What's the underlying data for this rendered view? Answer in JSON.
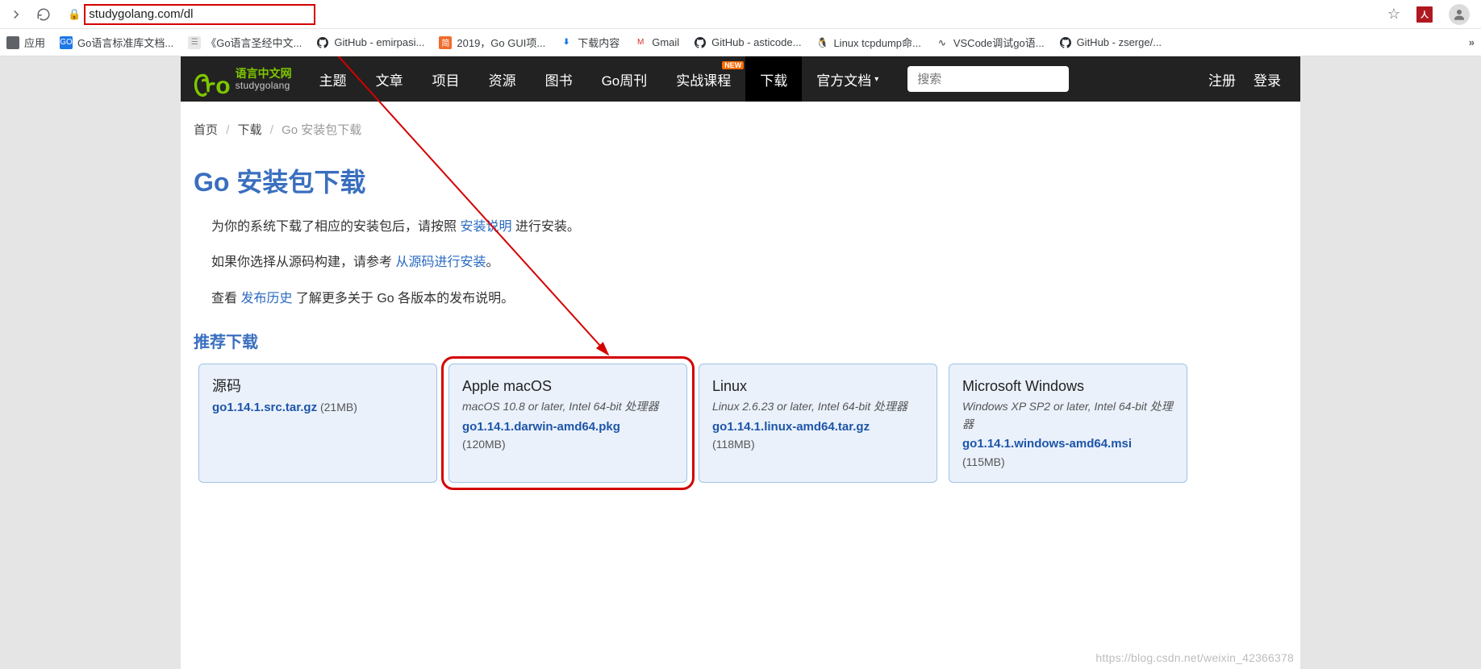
{
  "browser": {
    "url": "studygolang.com/dl",
    "bookmarks": [
      {
        "label": "应用",
        "icon_bg": "#5f6368",
        "icon_text": ""
      },
      {
        "label": "Go语言标准库文档...",
        "icon_bg": "#1e78e6",
        "icon_text": "GO"
      },
      {
        "label": "《Go语言圣经中文...",
        "icon_bg": "#e8e8e8",
        "icon_text": "☰",
        "icon_fg": "#888"
      },
      {
        "label": "GitHub - emirpasi...",
        "icon_bg": "#fff",
        "icon_text": "",
        "github": true
      },
      {
        "label": "2019，Go GUI项...",
        "icon_bg": "#ef6c2c",
        "icon_text": "简"
      },
      {
        "label": "下载内容",
        "icon_bg": "#fff",
        "icon_text": "",
        "dl": true
      },
      {
        "label": "Gmail",
        "icon_bg": "#fff",
        "icon_text": "M",
        "icon_fg": "#d93025"
      },
      {
        "label": "GitHub - asticode...",
        "icon_bg": "#fff",
        "icon_text": "",
        "github": true
      },
      {
        "label": "Linux tcpdump命...",
        "icon_bg": "#fff",
        "icon_text": "",
        "linux": true
      },
      {
        "label": "VSCode调试go语...",
        "icon_bg": "#fff",
        "icon_text": "",
        "vscode": true
      },
      {
        "label": "GitHub - zserge/...",
        "icon_bg": "#fff",
        "icon_text": "",
        "github": true
      }
    ],
    "pdf_label": "人"
  },
  "nav": {
    "logo_cn": "语言中文网",
    "logo_en": "studygolang",
    "items": [
      {
        "label": "主题"
      },
      {
        "label": "文章"
      },
      {
        "label": "项目"
      },
      {
        "label": "资源"
      },
      {
        "label": "图书"
      },
      {
        "label": "Go周刊"
      },
      {
        "label": "实战课程",
        "badge": "NEW"
      },
      {
        "label": "下载",
        "active": true
      },
      {
        "label": "官方文档",
        "dropdown": true
      }
    ],
    "search_placeholder": "搜索",
    "register": "注册",
    "login": "登录"
  },
  "crumb": {
    "home": "首页",
    "dl": "下载",
    "cur": "Go 安装包下载"
  },
  "page": {
    "title": "Go 安装包下载",
    "p1_a": "为你的系统下载了相应的安装包后，请按照 ",
    "p1_link": "安装说明",
    "p1_b": " 进行安装。",
    "p2_a": "如果你选择从源码构建，请参考 ",
    "p2_link": "从源码进行安装",
    "p2_b": "。",
    "p3_a": "查看 ",
    "p3_link": "发布历史",
    "p3_b": " 了解更多关于 Go 各版本的发布说明。",
    "sub": "推荐下载"
  },
  "cards": [
    {
      "title": "源码",
      "desc": "",
      "file": "go1.14.1.src.tar.gz",
      "size": "(21MB)",
      "inline_size": true
    },
    {
      "title": "Apple macOS",
      "desc": "macOS 10.8 or later, Intel 64-bit 处理器",
      "file": "go1.14.1.darwin-amd64.pkg",
      "size": "(120MB)",
      "highlight": true
    },
    {
      "title": "Linux",
      "desc": "Linux 2.6.23 or later, Intel 64-bit 处理器",
      "file": "go1.14.1.linux-amd64.tar.gz",
      "size": "(118MB)"
    },
    {
      "title": "Microsoft Windows",
      "desc": "Windows XP SP2 or later, Intel 64-bit 处理器",
      "file": "go1.14.1.windows-amd64.msi",
      "size": "(115MB)"
    }
  ],
  "watermark": "https://blog.csdn.net/weixin_42366378"
}
